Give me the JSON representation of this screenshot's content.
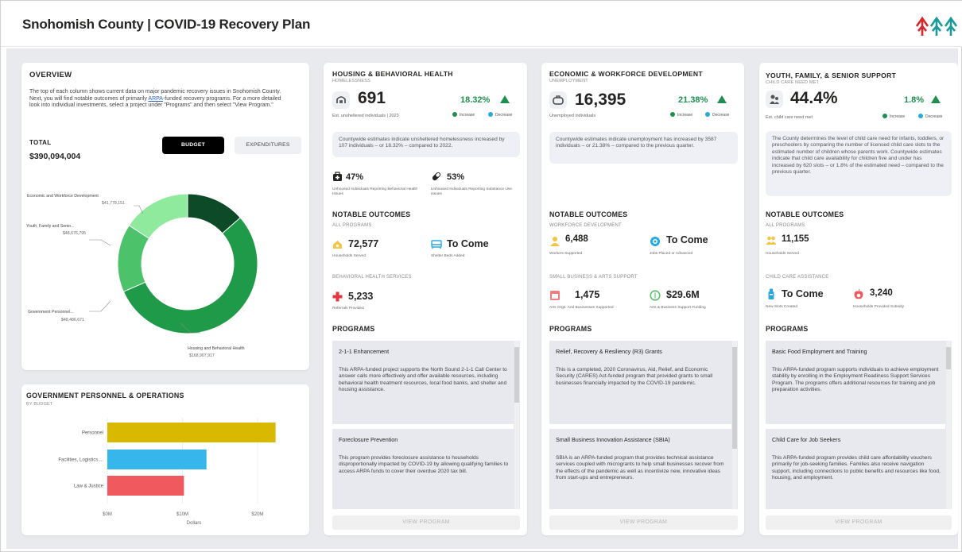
{
  "header": {
    "title": "Snohomish County | COVID-19 Recovery Plan"
  },
  "overview": {
    "title": "OVERVIEW",
    "intro_1": "The top of each column shows current data on major pandemic recovery issues in Snohomish County. Next, you will find notable outcomes of primarily ",
    "intro_link": "ARPA",
    "intro_2": "-funded recovery programs. For a more detailed look into individual investments, select a project under \"Programs\" and then select \"View Program.\"",
    "total_label": "TOTAL",
    "total_value": "$390,094,004",
    "budget_button": "BUDGET",
    "expenditures_button": "EXPENDITURES",
    "donut": {
      "segments": [
        {
          "name": "Housing and Behavioral Health",
          "value": "$168,907,917",
          "share": 0.473,
          "color": "#1f9a49"
        },
        {
          "name": "Government Personnel...",
          "value": "$48,486,671",
          "share": 0.136,
          "color": "#4cc26a"
        },
        {
          "name": "Youth, Family and Senio...",
          "value": "$48,676,795",
          "share": 0.136,
          "color": "#90ea9e"
        },
        {
          "name": "Economic and Workforce Development",
          "value": "$41,778,151",
          "share": 0.117,
          "color": "#0c4a28"
        }
      ]
    }
  },
  "gov": {
    "title": "GOVERNMENT PERSONNEL & OPERATIONS",
    "subtitle": "BY BUDGET",
    "chart_data": {
      "type": "bar",
      "categories": [
        "Personnel",
        "Facilities, Logistics ...",
        "Law & Justice"
      ],
      "values": [
        22.4,
        13.2,
        10.2
      ],
      "colors": [
        "#d9b800",
        "#37b6ec",
        "#f05a5e"
      ],
      "xticks": [
        "$0M",
        "$10M",
        "$20M"
      ],
      "xlabel": "Dollars",
      "xlim": [
        0,
        23.5
      ]
    }
  },
  "housing": {
    "title": "HOUSING & BEHAVIORAL HEALTH",
    "subtitle": "HOMELESSNESS",
    "value": "691",
    "pct": "18.32%",
    "label": "Est. unsheltered individuals | 2023",
    "increase": "Increase",
    "decrease": "Decrease",
    "desc": "Countywide estimates indicate unsheltered homelessness increased by 107 individuals – or 18.32% – compared to 2022.",
    "stat1_value": "47%",
    "stat1_label": "Unhoused Individuals Reporting Behavioral Health Issues",
    "stat2_value": "53%",
    "stat2_label": "Unhoused Individuals Reporting Substance Use Issues",
    "outcomes_title": "NOTABLE OUTCOMES",
    "group1": "ALL PROGRAMS",
    "m1_value": "72,577",
    "m1_label": "Households Served",
    "m2_value": "To Come",
    "m2_label": "Shelter Beds Added",
    "group2": "BEHAVIORAL HEALTH SERVICES",
    "m3_value": "5,233",
    "m3_label": "Referrals Provided",
    "programs_title": "PROGRAMS",
    "programs": [
      {
        "title": "2-1-1 Enhancement",
        "desc": "This ARPA-funded project supports the North Sound 2-1-1 Call Center to answer calls more effectively and offer available resources, including behavioral health treatment resources, local food banks, and shelter and housing assistance."
      },
      {
        "title": "Foreclosure Prevention",
        "desc": "This program provides foreclosure assistance to households disproportionally impacted by COVID-19 by allowing qualifying families to access ARPA funds to cover their overdue 2020 tax bill."
      }
    ],
    "view": "VIEW PROGRAM"
  },
  "economic": {
    "title": "ECONOMIC & WORKFORCE DEVELOPMENT",
    "subtitle": "UNEMPLOYMENT",
    "value": "16,395",
    "pct": "21.38%",
    "label": "Unemployed individuals",
    "increase": "Increase",
    "decrease": "Decrease",
    "desc": "Countywide estimates indicate unemployment has increased by 3587 individuals – or 21.38% – compared to the previous quarter.",
    "outcomes_title": "NOTABLE OUTCOMES",
    "group1": "WORKFORCE DEVELOPMENT",
    "m1_value": "6,488",
    "m1_label": "Workers Supported",
    "m2_value": "To Come",
    "m2_label": "Jobs Placed or Advanced",
    "group2": "SMALL BUSINESS & ARTS SUPPORT",
    "m3_value": "1,475",
    "m3_label": "Arts Orgs. And Businesses Supported",
    "m4_value": "$29.6M",
    "m4_label": "Arts & Business Support Funding",
    "programs_title": "PROGRAMS",
    "programs": [
      {
        "title": "Relief, Recovery & Resiliency (R3) Grants",
        "desc": "This is a completed, 2020 Coronavirus, Aid, Relief, and Economic Security (CARES) Act-funded program that provided grants to small businesses financially impacted by the COVID-19 pandemic."
      },
      {
        "title": "Small Business Innovation Assistance (SBIA)",
        "desc": "SBIA is an ARPA-funded program that provides technical assistance services coupled with microgrants to help small businesses recover from the effects of the pandemic as well as incentivize new, innovative ideas from start-ups and entrepreneurs."
      }
    ],
    "view": "VIEW PROGRAM"
  },
  "youth": {
    "title": "YOUTH, FAMILY, & SENIOR SUPPORT",
    "subtitle": "CHILD CARE NEED MET",
    "value": "44.4%",
    "pct": "1.8%",
    "label": "Est. child care need met",
    "increase": "Increase",
    "decrease": "Decrease",
    "desc": "The County determines the level of child care need for infants, toddlers, or preschoolers by comparing the number of licensed child care slots to the estimated number of children whose parents work. Countywide estimates indicate that child care availability for children five and under has increased by 620 slots – or 1.8% of the estimated need – compared to the previous quarter.",
    "outcomes_title": "NOTABLE OUTCOMES",
    "group1": "ALL PROGRAMS",
    "m1_value": "11,155",
    "m1_label": "Households Served",
    "group2": "CHILD CARE ASSISTANCE",
    "m2_value": "To Come",
    "m2_label": "New Slots Created",
    "m3_value": "3,240",
    "m3_label": "Households Provided Subsidy",
    "programs_title": "PROGRAMS",
    "programs": [
      {
        "title": "Basic Food Employment and Training",
        "desc": "This ARPA-funded program supports individuals to achieve employment stability by enrolling in the Employment Readiness Support Services Program. The programs offers additional resources for training and job preparation activities."
      },
      {
        "title": "Child Care for Job Seekers",
        "desc": "This ARPA-funded program provides child care affordability vouchers primarily for job-seeking families. Families also receive navigation support, including connections to public benefits and resources like food, housing, and employment."
      }
    ],
    "view": "VIEW PROGRAM"
  }
}
